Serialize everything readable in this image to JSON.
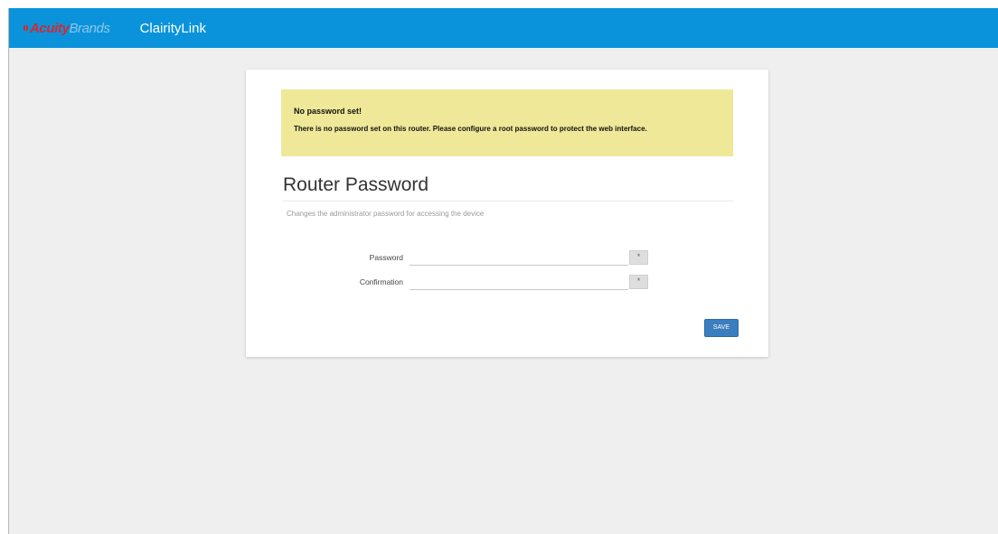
{
  "header": {
    "brand_prefix": "Acuity",
    "brand_suffix": "Brands",
    "app_title": "ClairityLink",
    "colors": {
      "bar": "#0a93db",
      "brand_red": "#d7282f"
    }
  },
  "alert": {
    "title": "No password set!",
    "message": "There is no password set on this router. Please configure a root password to protect the web interface."
  },
  "section": {
    "title": "Router Password",
    "description": "Changes the administrator password for accessing the device"
  },
  "form": {
    "password": {
      "label": "Password",
      "value": "",
      "reveal_icon": "*"
    },
    "confirmation": {
      "label": "Confirmation",
      "value": "",
      "reveal_icon": "*"
    },
    "save_label": "SAVE"
  }
}
